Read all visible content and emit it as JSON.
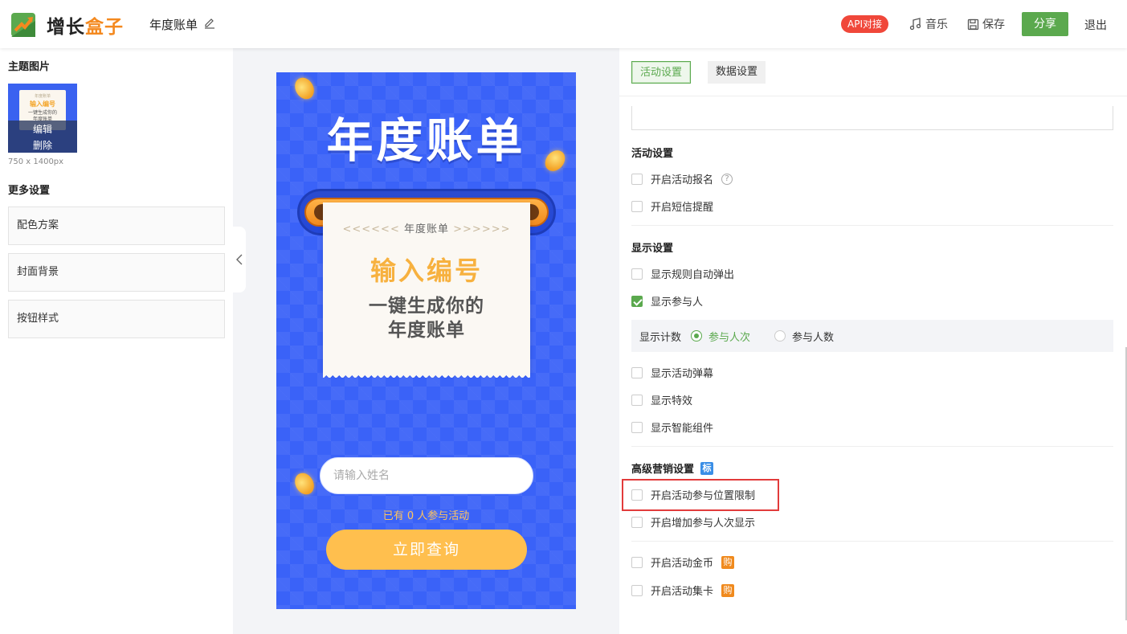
{
  "header": {
    "logo_part1": "增长",
    "logo_part2": "盒子",
    "doc_title": "年度账单",
    "api_label": "API对接",
    "music_label": "音乐",
    "save_label": "保存",
    "share_label": "分享",
    "exit_label": "退出"
  },
  "left": {
    "theme_image_title": "主题图片",
    "thumb_sub": "年度账单",
    "thumb_h1": "输入编号",
    "thumb_h2a": "一键生成你的",
    "thumb_h2b": "年度账单",
    "edit_label": "编辑",
    "delete_label": "删除",
    "image_size": "750 x 1400px",
    "more_title": "更多设置",
    "more_items": [
      "配色方案",
      "封面背景",
      "按钮样式"
    ]
  },
  "preview": {
    "title": "年度账单",
    "sub_left": "<<<<<<",
    "sub_text": "年度账单",
    "sub_right": ">>>>>>",
    "h1": "输入编号",
    "h2a": "一键生成你的",
    "h2b": "年度账单",
    "name_placeholder": "请输入姓名",
    "joined_prefix": "已有",
    "joined_count": "0",
    "joined_suffix": "人参与活动",
    "query_label": "立即查询"
  },
  "right": {
    "tabs": [
      "活动设置",
      "数据设置"
    ],
    "activity_settings_title": "活动设置",
    "activity_options": [
      "开启活动报名",
      "开启短信提醒"
    ],
    "display_settings_title": "显示设置",
    "display_options": [
      "显示规则自动弹出",
      "显示参与人"
    ],
    "count_label": "显示计数",
    "count_options": [
      "参与人次",
      "参与人数"
    ],
    "display_options2": [
      "显示活动弹幕",
      "显示特效",
      "显示智能组件"
    ],
    "advanced_title": "高级营销设置",
    "advanced_badge": "标",
    "advanced_options": [
      "开启活动参与位置限制",
      "开启增加参与人次显示"
    ],
    "paid_options": [
      "开启活动金币",
      "开启活动集卡"
    ],
    "paid_badge": "购",
    "help_icon": "?"
  },
  "colors": {
    "brand_green": "#5ba94e",
    "api_red": "#f0473a",
    "phone_blue": "#3a62f8",
    "accent_orange": "#f4891f"
  }
}
